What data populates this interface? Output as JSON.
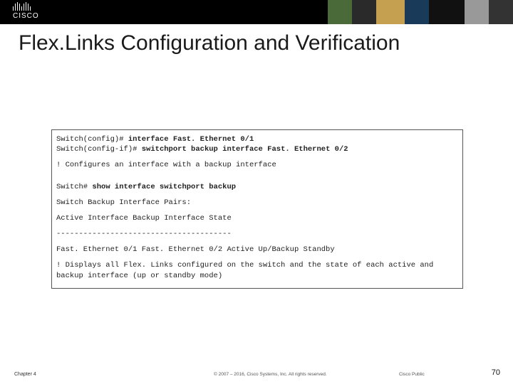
{
  "header": {
    "brand": "CISCO"
  },
  "title": "Flex.Links Configuration and Verification",
  "cli": {
    "l1_prompt": "Switch(config)# ",
    "l1_cmd": "interface Fast. Ethernet 0/1",
    "l2_prompt": "Switch(config-if)# ",
    "l2_cmd": "switchport backup interface Fast. Ethernet 0/2",
    "comment1": "! Configures an interface with a backup interface",
    "l3_prompt": "Switch# ",
    "l3_cmd": "show interface switchport backup",
    "out1": "Switch Backup Interface Pairs:",
    "out2": "Active Interface Backup Interface State",
    "out3": "---------------------------------------",
    "out4": "Fast. Ethernet 0/1 Fast. Ethernet 0/2 Active Up/Backup Standby",
    "comment2a": "! Displays all Flex. Links configured on the switch and the state of each active and",
    "comment2b": "backup interface (up or standby mode)"
  },
  "footer": {
    "chapter": "Chapter 4",
    "copyright": "© 2007 – 2016, Cisco Systems, Inc. All rights reserved.",
    "public": "Cisco Public",
    "page": "70"
  }
}
